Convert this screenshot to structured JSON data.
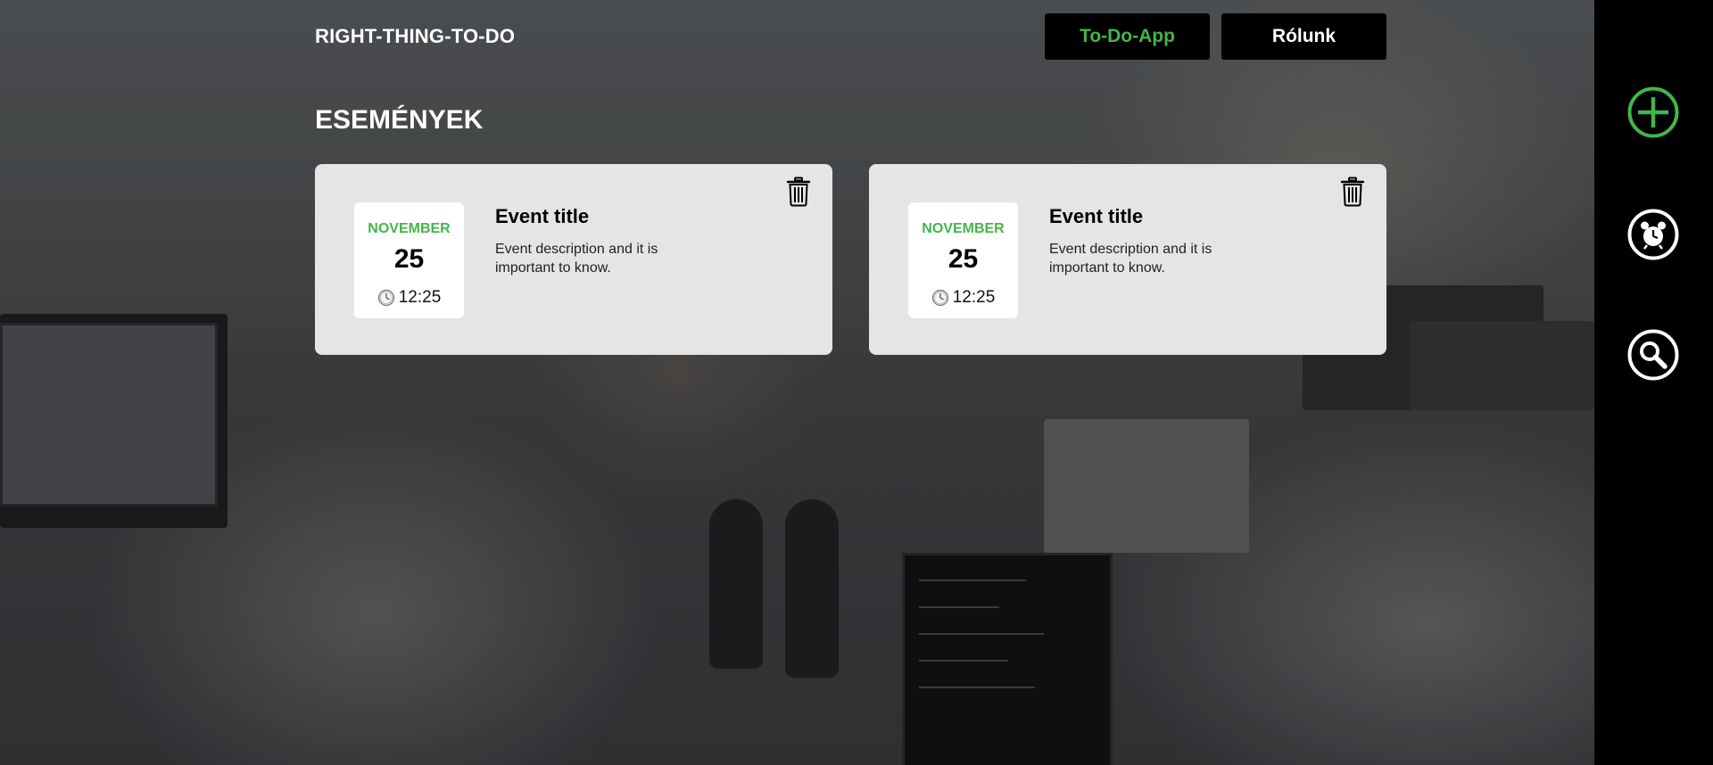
{
  "header": {
    "brand": "RIGHT-THING-TO-DO",
    "nav": [
      {
        "label": "To-Do-App",
        "color": "#43b649"
      },
      {
        "label": "Rólunk",
        "color": "#ffffff"
      }
    ]
  },
  "main": {
    "section_title": "ESEMÉNYEK",
    "events": [
      {
        "month": "NOVEMBER",
        "day": "25",
        "time": "12:25",
        "title": "Event title",
        "description": "Event description and it is important to know."
      },
      {
        "month": "NOVEMBER",
        "day": "25",
        "time": "12:25",
        "title": "Event title",
        "description": "Event description and it is important to know."
      }
    ]
  },
  "sidebar": {
    "buttons": [
      {
        "icon": "add-circle-icon",
        "color": "#43b649"
      },
      {
        "icon": "alarm-clock-icon",
        "color": "#ffffff"
      },
      {
        "icon": "search-icon",
        "color": "#ffffff"
      }
    ]
  },
  "colors": {
    "accent": "#43b649",
    "card_bg": "#e5e5e5",
    "sidebar_bg": "#000000"
  }
}
